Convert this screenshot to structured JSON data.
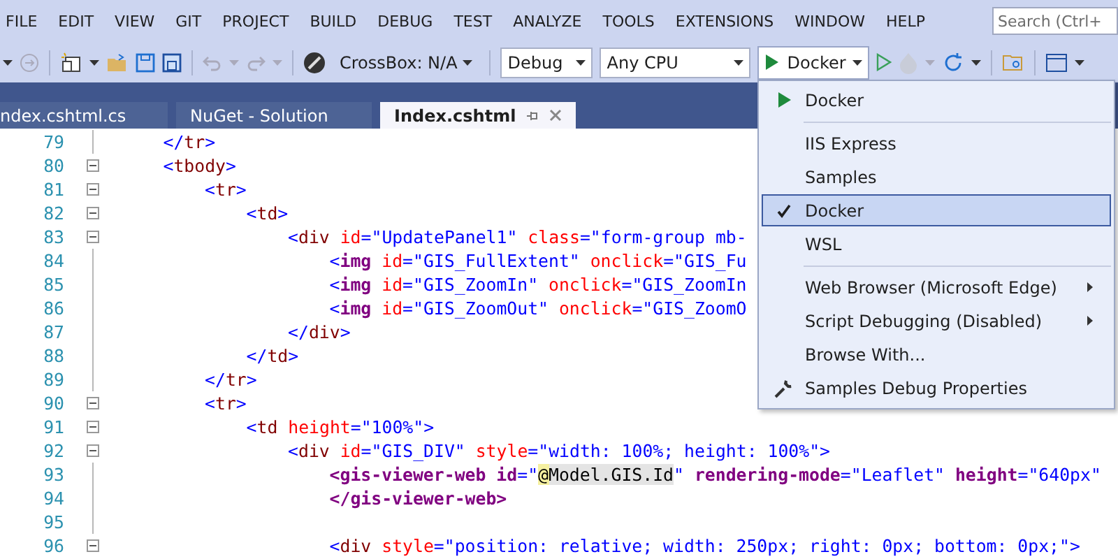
{
  "menu_bar": {
    "items": [
      "FILE",
      "EDIT",
      "VIEW",
      "GIT",
      "PROJECT",
      "BUILD",
      "DEBUG",
      "TEST",
      "ANALYZE",
      "TOOLS",
      "EXTENSIONS",
      "WINDOW",
      "HELP"
    ],
    "search": {
      "placeholder": "Search (Ctrl+"
    }
  },
  "toolbar": {
    "crossbox": "CrossBox: N/A",
    "configuration": "Debug",
    "platform": "Any CPU",
    "run_target": "Docker"
  },
  "tabs": [
    {
      "label": "ndex.cshtml.cs",
      "selected": false
    },
    {
      "label": "NuGet - Solution",
      "selected": false
    },
    {
      "label": "Index.cshtml",
      "selected": true
    }
  ],
  "editor": {
    "lines": [
      {
        "number": "79",
        "foldable": false,
        "tokens": [
          {
            "kind": "punct",
            "text": "</"
          },
          {
            "kind": "tag",
            "text": "tr"
          },
          {
            "kind": "punct",
            "text": ">"
          }
        ]
      },
      {
        "number": "80",
        "foldable": true,
        "tokens": [
          {
            "kind": "punct",
            "text": "<"
          },
          {
            "kind": "tag",
            "text": "tbody"
          },
          {
            "kind": "punct",
            "text": ">"
          }
        ],
        "children": [
          {
            "number": "81",
            "foldable": true,
            "tokens": [
              {
                "kind": "punct",
                "text": "<"
              },
              {
                "kind": "tag",
                "text": "tr"
              },
              {
                "kind": "punct",
                "text": ">"
              }
            ],
            "children": [
              {
                "number": "82",
                "foldable": true,
                "tokens": [
                  {
                    "kind": "punct",
                    "text": "<"
                  },
                  {
                    "kind": "tag",
                    "text": "td"
                  },
                  {
                    "kind": "punct",
                    "text": ">"
                  }
                ],
                "children": [
                  {
                    "number": "83",
                    "foldable": true,
                    "tokens": [
                      {
                        "kind": "punct",
                        "text": "<"
                      },
                      {
                        "kind": "tag",
                        "text": "div"
                      },
                      {
                        "kind": "attr",
                        "text": " id"
                      },
                      {
                        "kind": "punct",
                        "text": "="
                      },
                      {
                        "kind": "value",
                        "text": "\"UpdatePanel1\""
                      },
                      {
                        "kind": "attr",
                        "text": " class"
                      },
                      {
                        "kind": "punct",
                        "text": "="
                      },
                      {
                        "kind": "value",
                        "text": "\"form-group mb-"
                      }
                    ],
                    "children": [
                      {
                        "number": "84",
                        "foldable": false,
                        "tokens": [
                          {
                            "kind": "punct",
                            "text": "<"
                          },
                          {
                            "kind": "helper",
                            "text": "img"
                          },
                          {
                            "kind": "attr",
                            "text": " id"
                          },
                          {
                            "kind": "punct",
                            "text": "="
                          },
                          {
                            "kind": "value",
                            "text": "\"GIS_FullExtent\""
                          },
                          {
                            "kind": "attr",
                            "text": " onclick"
                          },
                          {
                            "kind": "punct",
                            "text": "="
                          },
                          {
                            "kind": "value",
                            "text": "\"GIS_Fu"
                          }
                        ]
                      },
                      {
                        "number": "85",
                        "foldable": false,
                        "tokens": [
                          {
                            "kind": "punct",
                            "text": "<"
                          },
                          {
                            "kind": "helper",
                            "text": "img"
                          },
                          {
                            "kind": "attr",
                            "text": " id"
                          },
                          {
                            "kind": "punct",
                            "text": "="
                          },
                          {
                            "kind": "value",
                            "text": "\"GIS_ZoomIn\""
                          },
                          {
                            "kind": "attr",
                            "text": " onclick"
                          },
                          {
                            "kind": "punct",
                            "text": "="
                          },
                          {
                            "kind": "value",
                            "text": "\"GIS_ZoomIn"
                          }
                        ]
                      },
                      {
                        "number": "86",
                        "foldable": false,
                        "tokens": [
                          {
                            "kind": "punct",
                            "text": "<"
                          },
                          {
                            "kind": "helper",
                            "text": "img"
                          },
                          {
                            "kind": "attr",
                            "text": " id"
                          },
                          {
                            "kind": "punct",
                            "text": "="
                          },
                          {
                            "kind": "value",
                            "text": "\"GIS_ZoomOut\""
                          },
                          {
                            "kind": "attr",
                            "text": " onclick"
                          },
                          {
                            "kind": "punct",
                            "text": "="
                          },
                          {
                            "kind": "value",
                            "text": "\"GIS_ZoomO"
                          }
                        ]
                      }
                    ]
                  },
                  {
                    "number": "87",
                    "foldable": false,
                    "tokens": [
                      {
                        "kind": "punct",
                        "text": "</"
                      },
                      {
                        "kind": "tag",
                        "text": "div"
                      },
                      {
                        "kind": "punct",
                        "text": ">"
                      }
                    ]
                  }
                ]
              },
              {
                "number": "88",
                "foldable": false,
                "tokens": [
                  {
                    "kind": "punct",
                    "text": "</"
                  },
                  {
                    "kind": "tag",
                    "text": "td"
                  },
                  {
                    "kind": "punct",
                    "text": ">"
                  }
                ]
              }
            ]
          },
          {
            "number": "89",
            "foldable": false,
            "tokens": [
              {
                "kind": "punct",
                "text": "</"
              },
              {
                "kind": "tag",
                "text": "tr"
              },
              {
                "kind": "punct",
                "text": ">"
              }
            ]
          },
          {
            "number": "90",
            "foldable": true,
            "tokens": [
              {
                "kind": "punct",
                "text": "<"
              },
              {
                "kind": "tag",
                "text": "tr"
              },
              {
                "kind": "punct",
                "text": ">"
              }
            ],
            "children": [
              {
                "number": "91",
                "foldable": true,
                "tokens": [
                  {
                    "kind": "punct",
                    "text": "<"
                  },
                  {
                    "kind": "tag",
                    "text": "td"
                  },
                  {
                    "kind": "attr",
                    "text": " height"
                  },
                  {
                    "kind": "punct",
                    "text": "="
                  },
                  {
                    "kind": "value",
                    "text": "\"100%\""
                  },
                  {
                    "kind": "punct",
                    "text": ">"
                  }
                ],
                "children": [
                  {
                    "number": "92",
                    "foldable": true,
                    "tokens": [
                      {
                        "kind": "punct",
                        "text": "<"
                      },
                      {
                        "kind": "tag",
                        "text": "div"
                      },
                      {
                        "kind": "attr",
                        "text": " id"
                      },
                      {
                        "kind": "punct",
                        "text": "="
                      },
                      {
                        "kind": "value",
                        "text": "\"GIS_DIV\""
                      },
                      {
                        "kind": "attr",
                        "text": " style"
                      },
                      {
                        "kind": "punct",
                        "text": "="
                      },
                      {
                        "kind": "value",
                        "text": "\"width: 100%; height: 100%\""
                      },
                      {
                        "kind": "punct",
                        "text": ">"
                      }
                    ],
                    "children": [
                      {
                        "number": "93",
                        "foldable": false,
                        "tokens": [
                          {
                            "kind": "helper",
                            "text": "<gis-viewer-web"
                          },
                          {
                            "kind": "hattr",
                            "text": " id"
                          },
                          {
                            "kind": "punct",
                            "text": "="
                          },
                          {
                            "kind": "value",
                            "text": "\""
                          },
                          {
                            "kind": "razor",
                            "text": "@"
                          },
                          {
                            "kind": "code",
                            "text": "Model.GIS.Id"
                          },
                          {
                            "kind": "value",
                            "text": "\""
                          },
                          {
                            "kind": "hattr",
                            "text": " rendering-mode"
                          },
                          {
                            "kind": "punct",
                            "text": "="
                          },
                          {
                            "kind": "value",
                            "text": "\"Leaflet\""
                          },
                          {
                            "kind": "hattr",
                            "text": " height"
                          },
                          {
                            "kind": "punct",
                            "text": "="
                          },
                          {
                            "kind": "value",
                            "text": "\"640px\""
                          }
                        ]
                      },
                      {
                        "number": "94",
                        "foldable": false,
                        "tokens": [
                          {
                            "kind": "helper",
                            "text": "</gis-viewer-web>"
                          }
                        ]
                      },
                      {
                        "number": "95",
                        "foldable": false
                      },
                      {
                        "number": "96",
                        "foldable": true,
                        "tokens": [
                          {
                            "kind": "punct",
                            "text": "<"
                          },
                          {
                            "kind": "tag",
                            "text": "div"
                          },
                          {
                            "kind": "attr",
                            "text": " style"
                          },
                          {
                            "kind": "punct",
                            "text": "="
                          },
                          {
                            "kind": "value",
                            "text": "\"position: relative; width: 250px; right: 0px; bottom: 0px;\""
                          },
                          {
                            "kind": "punct",
                            "text": ">"
                          }
                        ]
                      }
                    ]
                  }
                ]
              }
            ]
          }
        ]
      }
    ]
  },
  "launch_menu": {
    "items": [
      {
        "kind": "header",
        "label": "Docker"
      },
      {
        "kind": "separator"
      },
      {
        "kind": "option",
        "label": "IIS Express",
        "checked": false,
        "selected": false
      },
      {
        "kind": "option",
        "label": "Samples",
        "checked": false,
        "selected": false
      },
      {
        "kind": "option",
        "label": "Docker",
        "checked": true,
        "selected": true
      },
      {
        "kind": "option",
        "label": "WSL",
        "checked": false,
        "selected": false
      },
      {
        "kind": "separator"
      },
      {
        "kind": "submenu",
        "label": "Web Browser (Microsoft Edge)"
      },
      {
        "kind": "submenu",
        "label": "Script Debugging (Disabled)"
      },
      {
        "kind": "command",
        "label": "Browse With..."
      },
      {
        "kind": "properties",
        "label": "Samples Debug Properties"
      }
    ]
  }
}
